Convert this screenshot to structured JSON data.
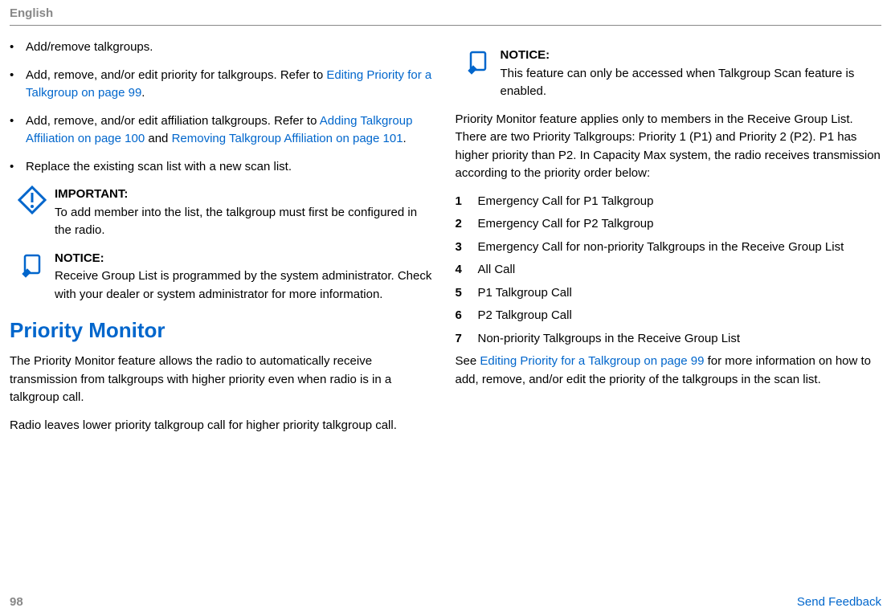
{
  "header": "English",
  "left": {
    "bullets": [
      {
        "pre": "Add/remove talkgroups."
      },
      {
        "pre": "Add, remove, and/or edit priority for talkgroups. Refer to ",
        "link1": "Editing Priority for a Talkgroup on page 99",
        "post1": "."
      },
      {
        "pre": "Add, remove, and/or edit affiliation talkgroups. Refer to ",
        "link1": "Adding Talkgroup Affiliation on page 100",
        "mid": " and ",
        "link2": "Removing Talkgroup Affiliation on page 101",
        "post2": "."
      },
      {
        "pre": "Replace the existing scan list with a new scan list."
      }
    ],
    "important": {
      "title": "IMPORTANT:",
      "body": "To add member into the list, the talkgroup must first be configured in the radio."
    },
    "notice": {
      "title": "NOTICE:",
      "body": "Receive Group List is programmed by the system administrator. Check with your dealer or system administrator for more information."
    },
    "section_title": "Priority Monitor",
    "para1": "The Priority Monitor feature allows the radio to automatically receive transmission from talkgroups with higher priority even when radio is in a talkgroup call.",
    "para2": "Radio leaves lower priority talkgroup call for higher priority talkgroup call."
  },
  "right": {
    "notice": {
      "title": "NOTICE:",
      "body": "This feature can only be accessed when Talkgroup Scan feature is enabled."
    },
    "para1": "Priority Monitor feature applies only to members in the Receive Group List. There are two Priority Talkgroups: Priority 1 (P1) and Priority 2 (P2). P1 has higher priority than P2. In Capacity Max system, the radio receives transmission according to the priority order below:",
    "list": [
      "Emergency Call for P1 Talkgroup",
      "Emergency Call for P2 Talkgroup",
      "Emergency Call for non-priority Talkgroups in the Receive Group List",
      "All Call",
      "P1 Talkgroup Call",
      "P2 Talkgroup Call",
      "Non-priority Talkgroups in the Receive Group List"
    ],
    "closing_pre": "See ",
    "closing_link": "Editing Priority for a Talkgroup on page 99",
    "closing_post": " for more information on how to add, remove, and/or edit the priority of the talkgroups in the scan list."
  },
  "footer": {
    "page": "98",
    "feedback": "Send Feedback"
  }
}
